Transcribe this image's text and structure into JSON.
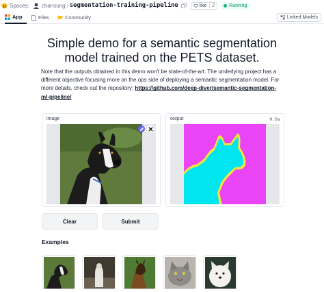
{
  "header": {
    "spaces_label": "Spaces:",
    "owner": "chansung",
    "separator": "/",
    "repo": "segmentation-training-pipeline",
    "like_label": "like",
    "like_count": "2",
    "status": "Running",
    "colors": {
      "running": "#10b981",
      "accent": "#6366f1",
      "mask_pet": "#00e5f0",
      "mask_background": "#e944f5",
      "mask_border": "#f3e53b"
    }
  },
  "tabs": [
    {
      "label": "App",
      "icon": "app-icon",
      "active": true
    },
    {
      "label": "Files",
      "icon": "files-icon",
      "active": false
    },
    {
      "label": "Community",
      "icon": "community-icon",
      "active": false
    }
  ],
  "linked_models": "Linked Models",
  "main": {
    "title": "Simple demo for a semantic segmentation model trained on the PETS dataset.",
    "description": "Note that the outputs obtained in this demo won't be state-of-the-art. The underlying project has a different objective focusing more on the ops side of deploying a semantic segmentation model. For more details, check out the repository: ",
    "link": "https://github.com/deep-diver/semantic-segmentation-ml-pipeline/",
    "input_label": "image",
    "output_label": "output",
    "timing": "0.0s",
    "clear_button": "Clear",
    "submit_button": "Submit",
    "examples_title": "Examples"
  },
  "examples": [
    {
      "name": "dog-black-white"
    },
    {
      "name": "dog-sitting-white"
    },
    {
      "name": "dog-shepherd"
    },
    {
      "name": "cat-gray"
    },
    {
      "name": "dog-white-fluffy"
    }
  ]
}
